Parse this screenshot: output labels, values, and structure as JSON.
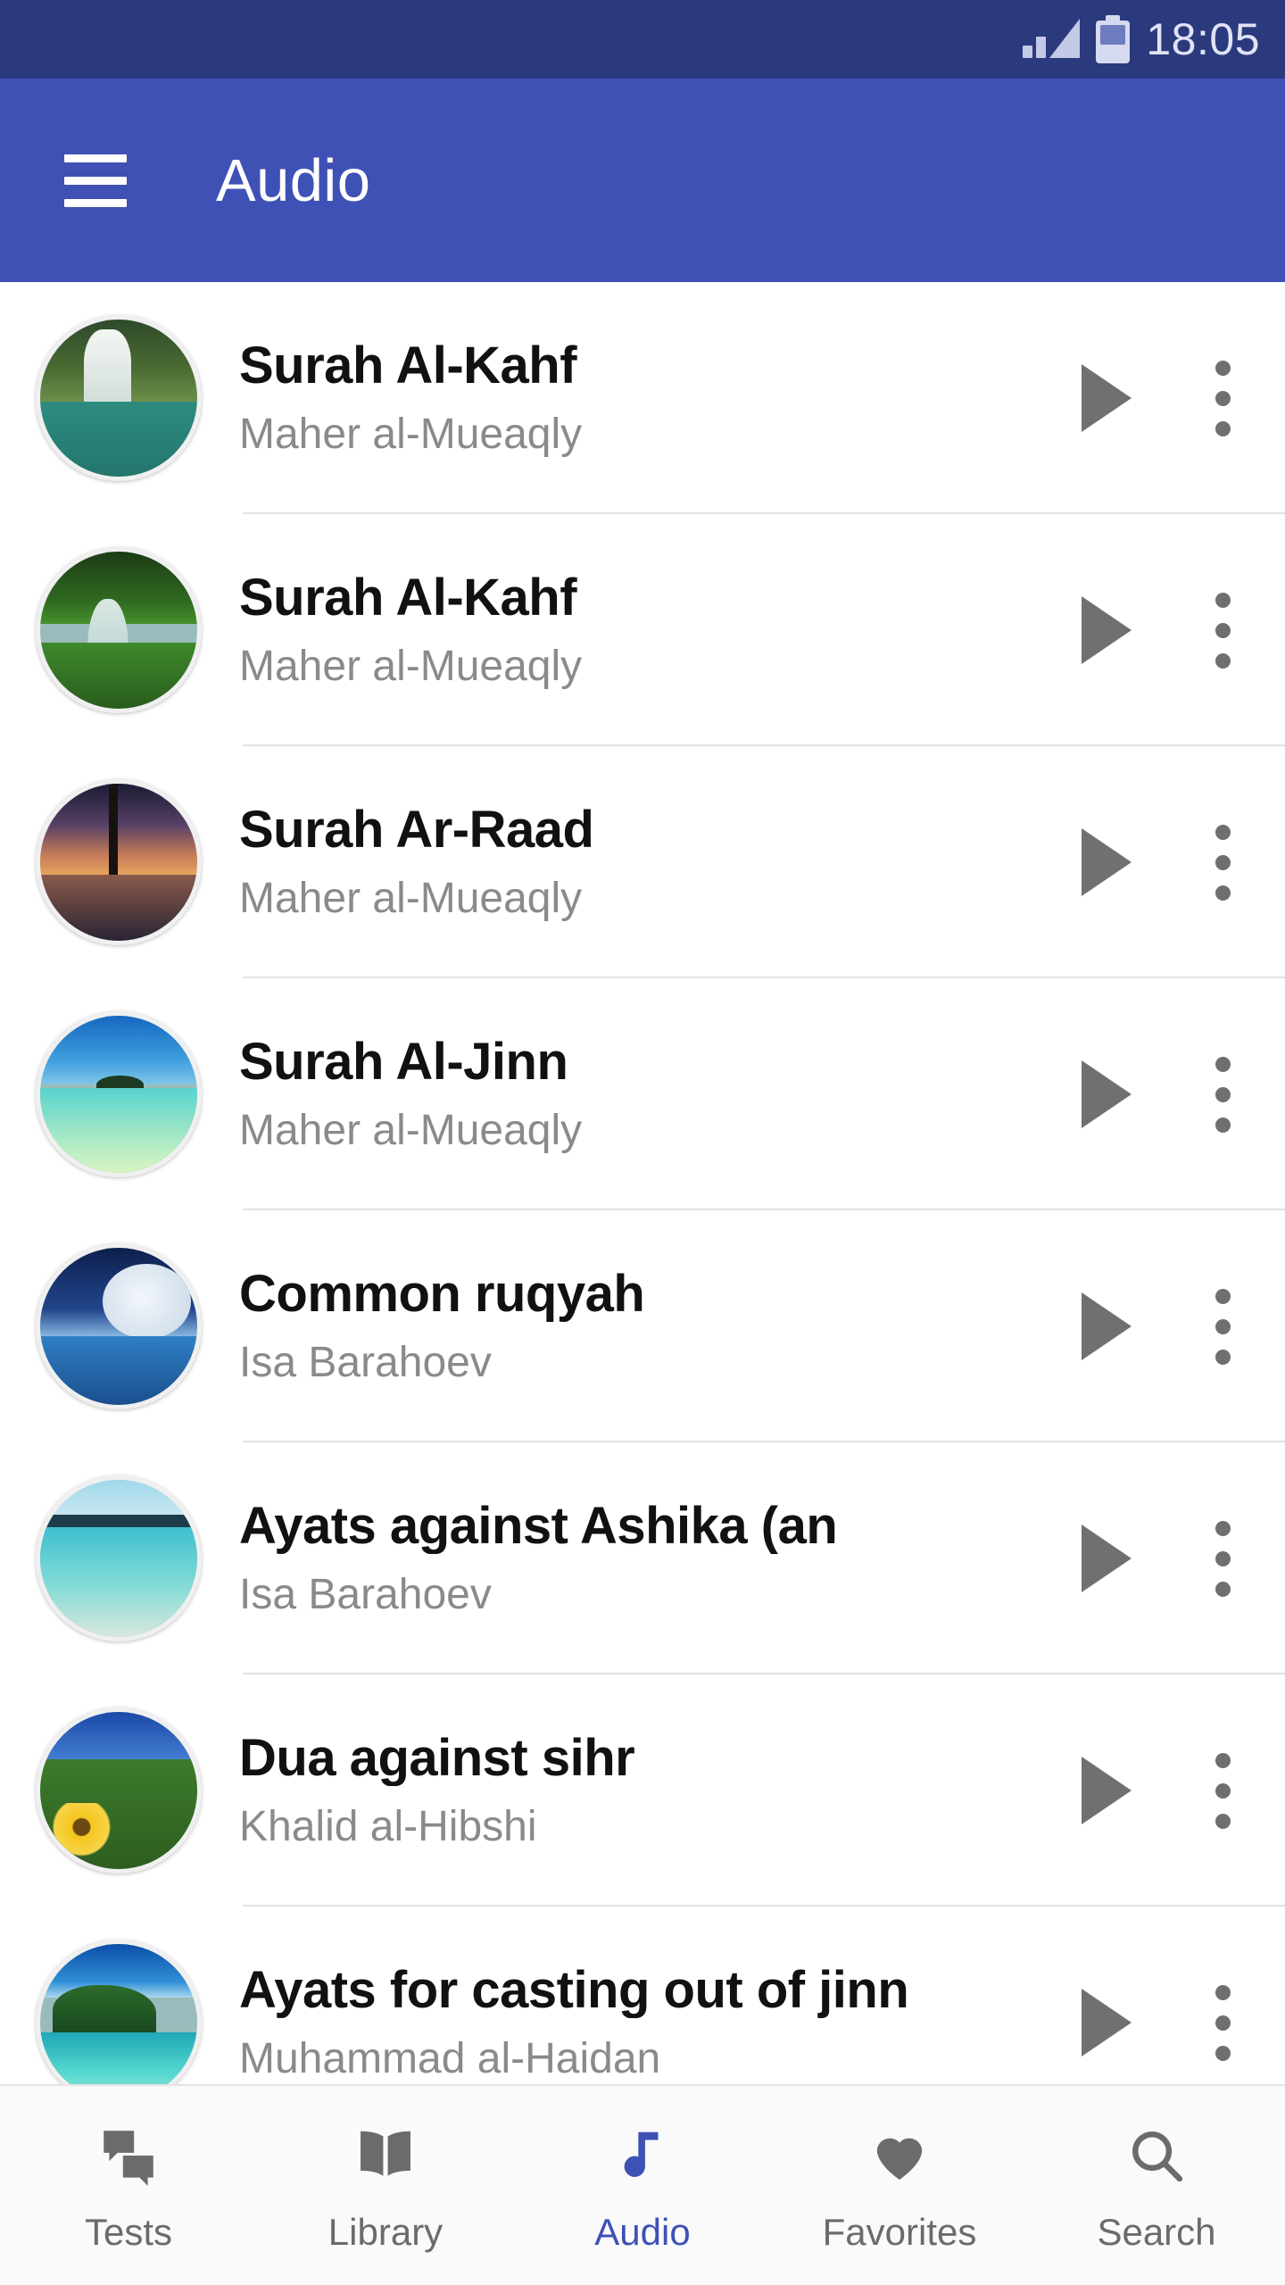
{
  "status_bar": {
    "time": "18:05",
    "signal_icon": "signal-bars-icon",
    "battery_icon": "battery-icon"
  },
  "app_bar": {
    "menu_icon": "hamburger-menu-icon",
    "title": "Audio",
    "background_color": "#3f51b5"
  },
  "colors": {
    "status_bar": "#2b3a7d",
    "app_bar": "#3f51b5",
    "accent": "#3f51b5",
    "title_text": "#111111",
    "subtitle_text": "#8a8a8a",
    "nav_inactive": "#6b6b6b",
    "divider": "#e2e2e2"
  },
  "list": {
    "play_icon": "play-icon",
    "more_icon": "more-vertical-icon",
    "items": [
      {
        "title": "Surah Al-Kahf",
        "artist": "Maher al-Mueaqly",
        "thumb": "waterfall-thumbnail"
      },
      {
        "title": "Surah Al-Kahf",
        "artist": "Maher al-Mueaqly",
        "thumb": "forest-stream-thumbnail"
      },
      {
        "title": "Surah Ar-Raad",
        "artist": "Maher al-Mueaqly",
        "thumb": "palm-sunset-thumbnail"
      },
      {
        "title": "Surah Al-Jinn",
        "artist": "Maher al-Mueaqly",
        "thumb": "tropical-island-thumbnail"
      },
      {
        "title": "Common ruqyah",
        "artist": "Isa Barahoev",
        "thumb": "moon-ocean-thumbnail"
      },
      {
        "title": "Ayats against Ashika (an",
        "artist": "Isa Barahoev",
        "thumb": "turquoise-beach-thumbnail"
      },
      {
        "title": "Dua against sihr",
        "artist": "Khalid al-Hibshi",
        "thumb": "sunflower-field-thumbnail"
      },
      {
        "title": "Ayats for casting out of jinn",
        "artist": "Muhammad al-Haidan",
        "thumb": "lagoon-island-thumbnail"
      }
    ]
  },
  "bottom_nav": {
    "active_index": 2,
    "items": [
      {
        "label": "Tests",
        "icon": "chat-bubbles-icon"
      },
      {
        "label": "Library",
        "icon": "open-book-icon"
      },
      {
        "label": "Audio",
        "icon": "music-note-icon"
      },
      {
        "label": "Favorites",
        "icon": "heart-icon"
      },
      {
        "label": "Search",
        "icon": "search-icon"
      }
    ]
  }
}
